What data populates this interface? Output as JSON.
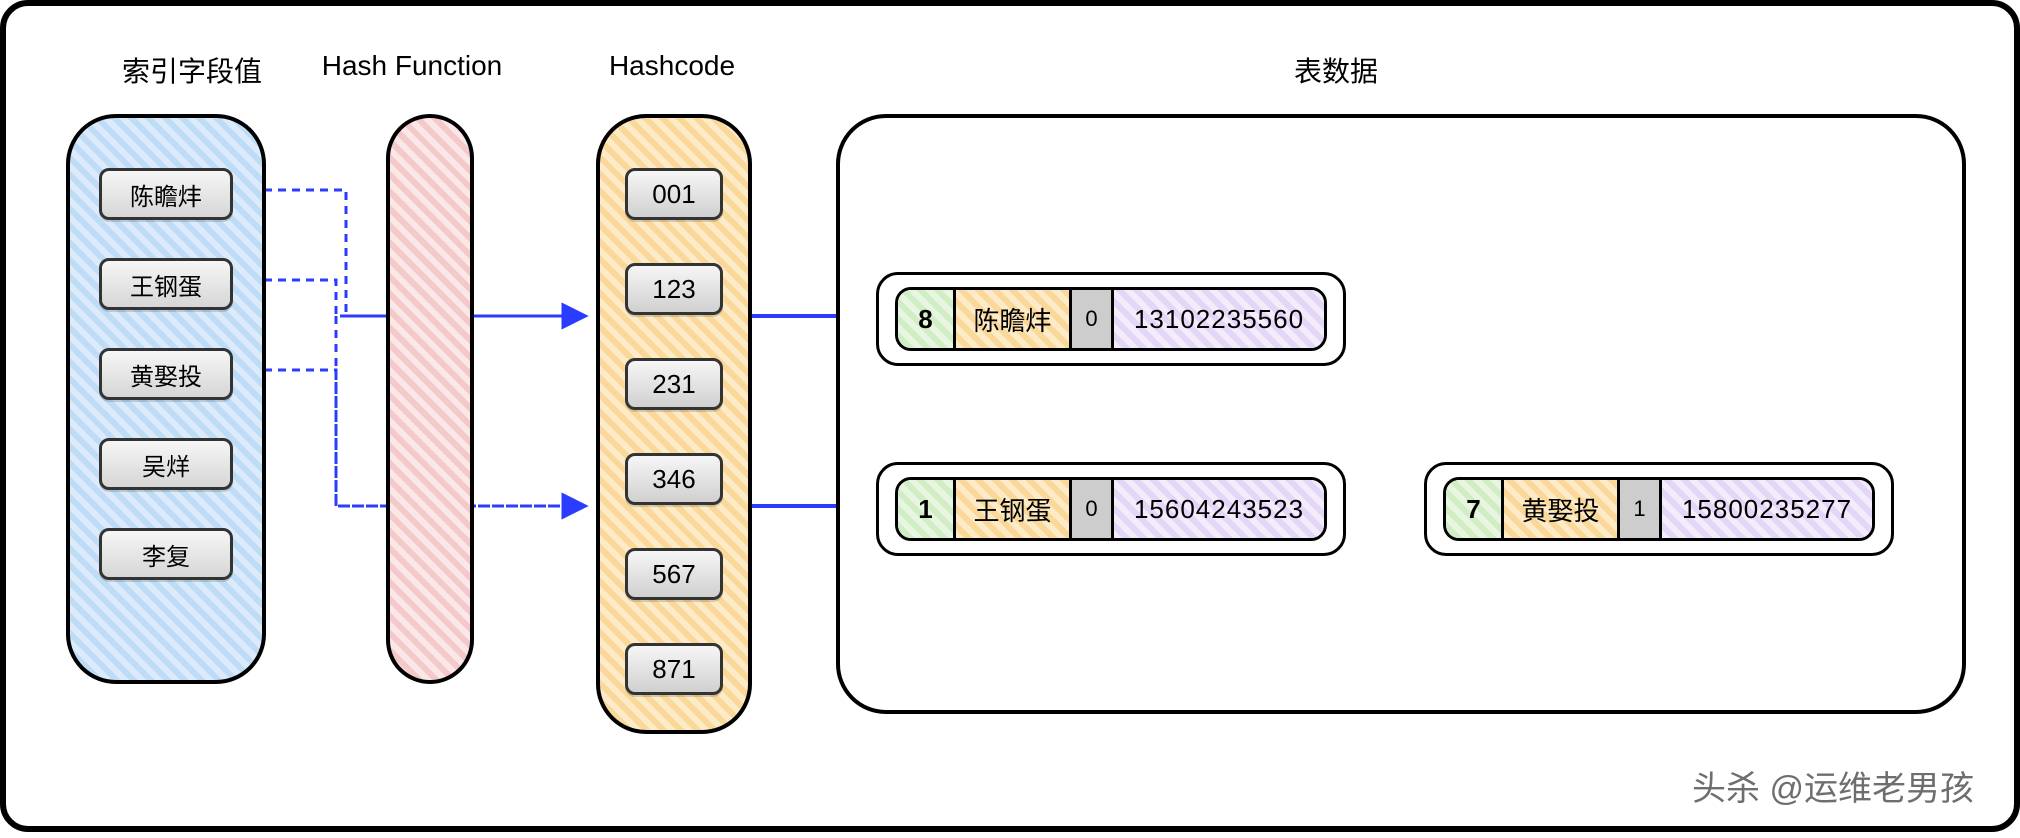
{
  "labels": {
    "index_col": "索引字段值",
    "hash_func": "Hash Function",
    "hashcode": "Hashcode",
    "table_data": "表数据"
  },
  "index_values": [
    "陈瞻炐",
    "王钢蛋",
    "黄娶投",
    "吴烊",
    "李复"
  ],
  "hashcodes": [
    "001",
    "123",
    "231",
    "346",
    "567",
    "871"
  ],
  "rows": [
    {
      "id": "8",
      "name": "陈瞻炐",
      "flag": "0",
      "phone": "13102235560"
    },
    {
      "id": "1",
      "name": "王钢蛋",
      "flag": "0",
      "phone": "15604243523"
    },
    {
      "id": "7",
      "name": "黄娶投",
      "flag": "1",
      "phone": "15800235277"
    }
  ],
  "watermark": "头杀 @运维老男孩"
}
